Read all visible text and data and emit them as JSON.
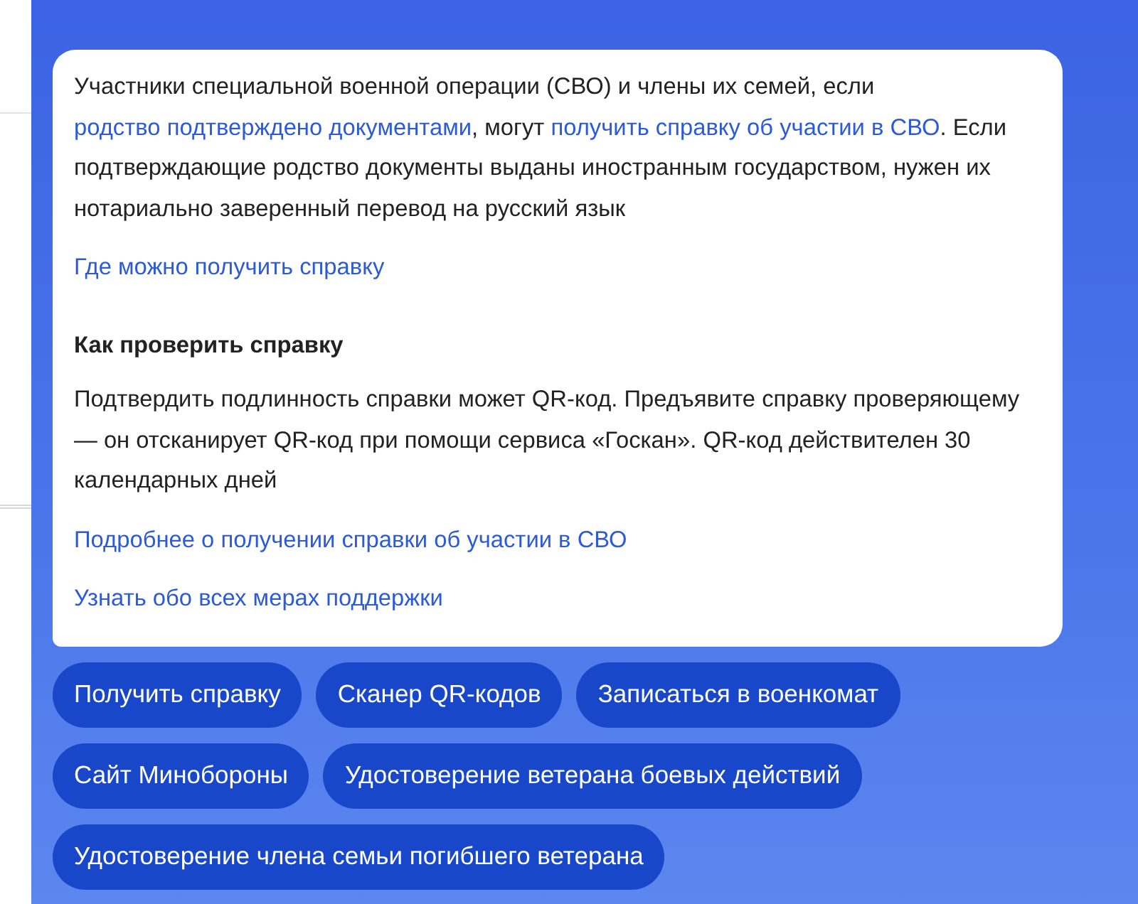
{
  "card": {
    "paragraphs": [
      {
        "segments": [
          {
            "kind": "text",
            "text": "Участники специальной военной операции (СВО) и члены их семей, если "
          },
          {
            "kind": "link",
            "text": "родство подтверждено документами"
          },
          {
            "kind": "text",
            "text": ", могут "
          },
          {
            "kind": "link",
            "text": "получить справку об участии в СВО"
          },
          {
            "kind": "text",
            "text": ". Если подтверждающие родство документы выданы иностранным государством, нужен их нотариально заверенный перевод на русский язык"
          }
        ]
      },
      {
        "segments": [
          {
            "kind": "link",
            "text": "Где можно получить справку"
          }
        ]
      },
      {
        "heading": "Как проверить справку"
      },
      {
        "segments": [
          {
            "kind": "text",
            "text": "Подтвердить подлинность справки может QR-код. Предъявите справку проверяющему — он отсканирует QR-код при помощи сервиса «Госкан». QR-код действителен 30 календарных дней"
          }
        ]
      },
      {
        "segments": [
          {
            "kind": "link",
            "text": "Подробнее о получении справки об участии в СВО"
          }
        ]
      },
      {
        "segments": [
          {
            "kind": "link",
            "text": "Узнать обо всех мерах поддержки"
          }
        ]
      }
    ]
  },
  "buttons": [
    "Получить справку",
    "Сканер QR-кодов",
    "Записаться в военкомат",
    "Сайт Минобороны",
    "Удостоверение ветерана боевых действий",
    "Удостоверение члена семьи погибшего ветерана"
  ]
}
